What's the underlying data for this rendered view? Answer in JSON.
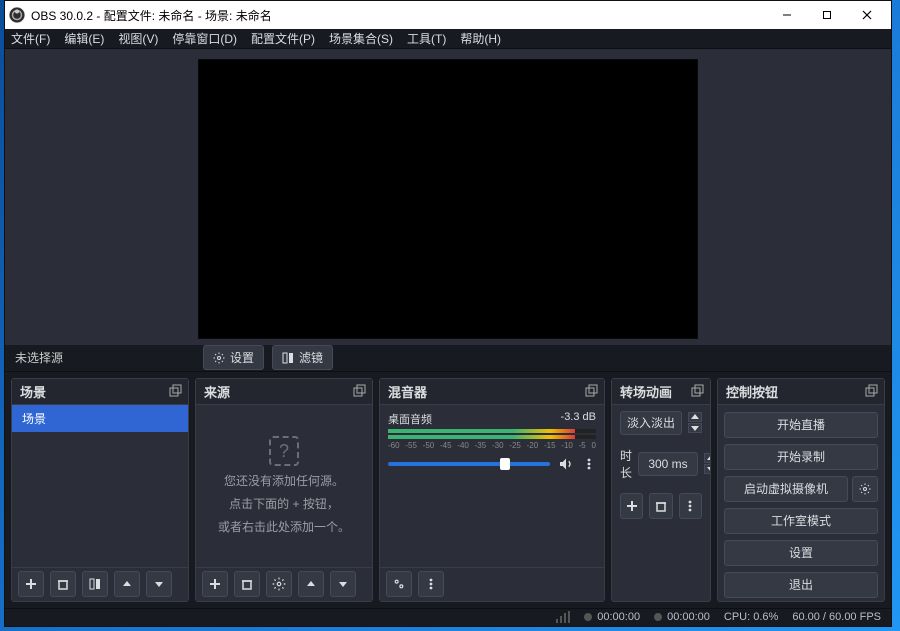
{
  "titlebar": {
    "title": "OBS 30.0.2 - 配置文件: 未命名 - 场景: 未命名"
  },
  "menubar": {
    "file": "文件(F)",
    "edit": "编辑(E)",
    "view": "视图(V)",
    "dock": "停靠窗口(D)",
    "profile": "配置文件(P)",
    "scene_col": "场景集合(S)",
    "tools": "工具(T)",
    "help": "帮助(H)"
  },
  "context": {
    "no_selection": "未选择源",
    "settings_btn": "设置",
    "filters_btn": "滤镜"
  },
  "docks": {
    "scenes": {
      "title": "场景",
      "items": [
        "场景"
      ],
      "selected": 0
    },
    "sources": {
      "title": "来源",
      "empty_line1": "您还没有添加任何源。",
      "empty_line2": "点击下面的 + 按钮，",
      "empty_line3": "或者右击此处添加一个。"
    },
    "mixer": {
      "title": "混音器",
      "channel_name": "桌面音频",
      "db_value": "-3.3 dB",
      "ticks": [
        "-60",
        "-55",
        "-50",
        "-45",
        "-40",
        "-35",
        "-30",
        "-25",
        "-20",
        "-15",
        "-10",
        "-5",
        "0"
      ]
    },
    "transitions": {
      "title": "转场动画",
      "selected": "淡入淡出",
      "duration_label": "时长",
      "duration_value": "300 ms"
    },
    "controls": {
      "title": "控制按钮",
      "start_stream": "开始直播",
      "start_record": "开始录制",
      "start_vcam": "启动虚拟摄像机",
      "studio_mode": "工作室模式",
      "settings": "设置",
      "exit": "退出"
    }
  },
  "statusbar": {
    "stream_time": "00:00:00",
    "rec_time": "00:00:00",
    "cpu": "CPU: 0.6%",
    "fps": "60.00 / 60.00 FPS"
  }
}
